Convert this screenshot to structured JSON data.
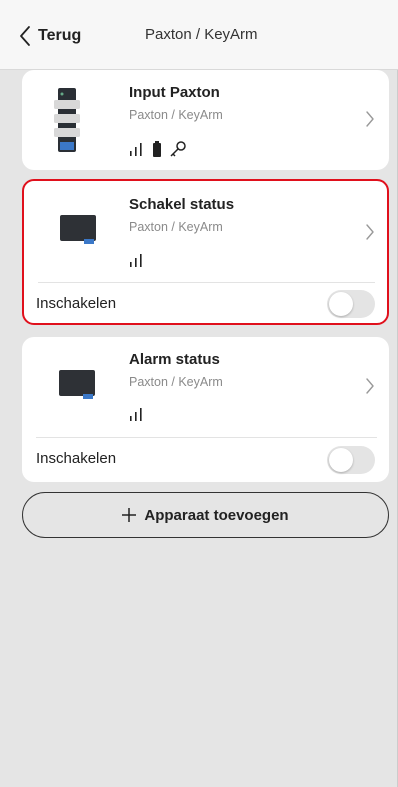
{
  "header": {
    "back_label": "Terug",
    "title": "Paxton / KeyArm"
  },
  "devices": [
    {
      "name": "Input Paxton",
      "subtitle": "Paxton / KeyArm",
      "icons": [
        "signal-icon",
        "battery-icon",
        "key-icon"
      ],
      "has_switch": false
    },
    {
      "name": "Schakel status",
      "subtitle": "Paxton / KeyArm",
      "icons": [
        "signal-icon"
      ],
      "has_switch": true,
      "switch_label": "Inschakelen",
      "switch_on": false,
      "highlighted": true
    },
    {
      "name": "Alarm status",
      "subtitle": "Paxton / KeyArm",
      "icons": [
        "signal-icon"
      ],
      "has_switch": true,
      "switch_label": "Inschakelen",
      "switch_on": false,
      "highlighted": false
    }
  ],
  "add_button": {
    "label": "Apparaat toevoegen",
    "icon": "plus-icon"
  },
  "colors": {
    "highlight_border": "#e0101c",
    "background": "#e5e5e5",
    "card": "#ffffff"
  }
}
